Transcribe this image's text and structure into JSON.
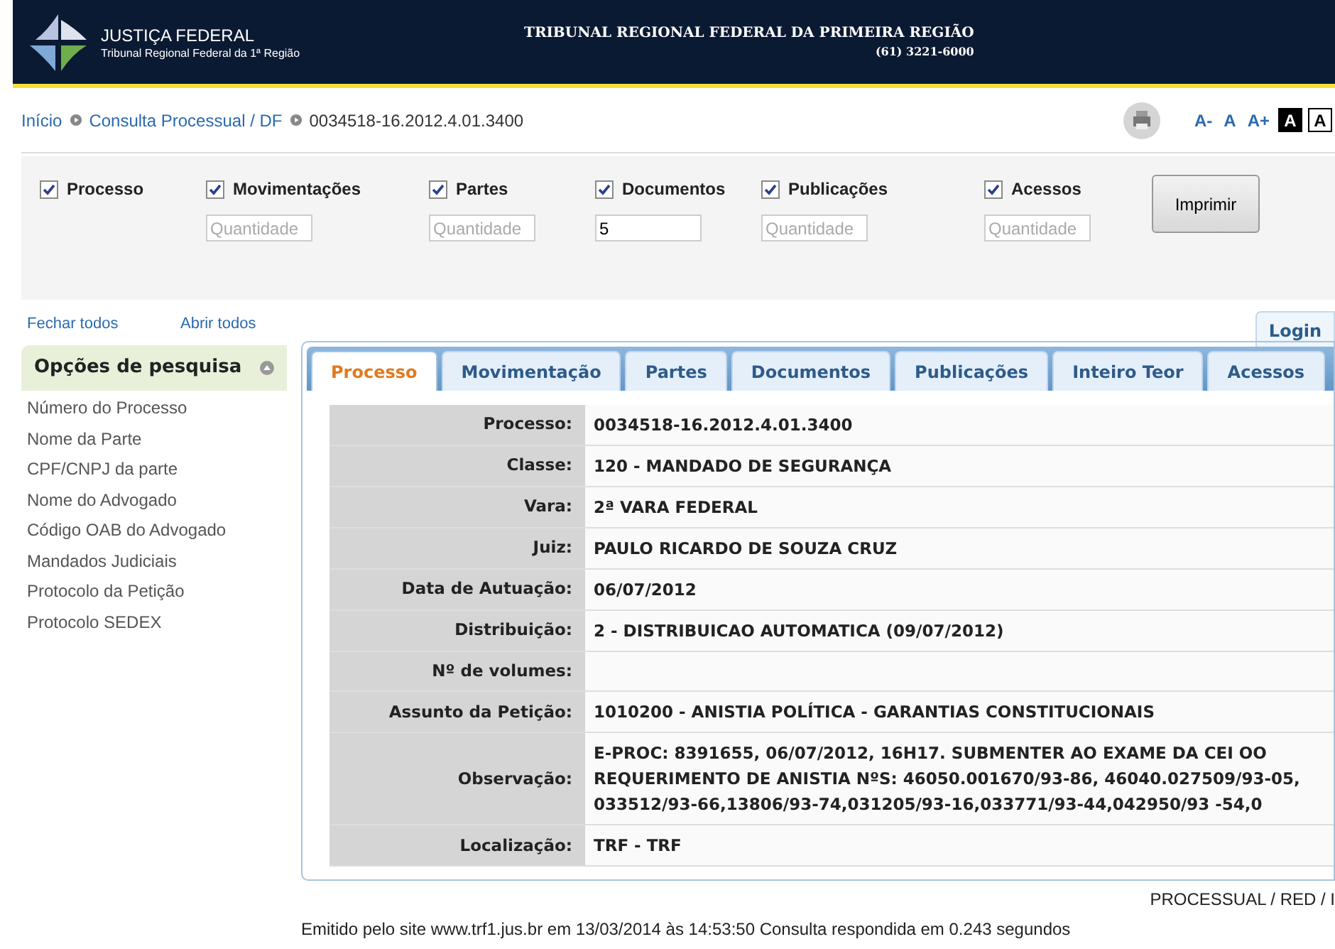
{
  "header": {
    "logo_title": "JUSTIÇA FEDERAL",
    "logo_subtitle": "Tribunal Regional Federal da 1ª Região",
    "title": "TRIBUNAL REGIONAL FEDERAL DA PRIMEIRA REGIÃO",
    "phone": "(61) 3221-6000"
  },
  "breadcrumb": [
    {
      "label": "Início",
      "link": true
    },
    {
      "label": "Consulta Processual / DF",
      "link": true
    },
    {
      "label": "0034518-16.2012.4.01.3400",
      "link": false
    }
  ],
  "font_sizes": [
    {
      "label": "A-",
      "kind": "link"
    },
    {
      "label": "A",
      "kind": "link"
    },
    {
      "label": "A+",
      "kind": "link"
    },
    {
      "label": "A",
      "kind": "dark"
    },
    {
      "label": "A",
      "kind": "light"
    }
  ],
  "print_options": [
    {
      "label": "Processo",
      "checked": true
    },
    {
      "label": "Movimentações",
      "checked": true,
      "quantity": {
        "placeholder": "Quantidade"
      }
    },
    {
      "label": "Partes",
      "checked": true,
      "quantity": {
        "placeholder": "Quantidade"
      }
    },
    {
      "label": "Documentos",
      "checked": true,
      "quantity": {
        "value": "5"
      }
    },
    {
      "label": "Publicações",
      "checked": true,
      "quantity": {
        "placeholder": "Quantidade"
      }
    },
    {
      "label": "Acessos",
      "checked": true,
      "quantity": {
        "placeholder": "Quantidade"
      }
    }
  ],
  "print_button": "Imprimir",
  "toggle_links": [
    "Fechar todos",
    "Abrir todos"
  ],
  "login_button": "Login",
  "sidebar": {
    "title": "Opções de pesquisa",
    "expanded": true,
    "items": [
      "Número do Processo",
      "Nome da Parte",
      "CPF/CNPJ da parte",
      "Nome do Advogado",
      "Código OAB do Advogado",
      "Mandados Judiciais",
      "Protocolo da Petição",
      "Protocolo SEDEX"
    ]
  },
  "tabs": [
    {
      "label": "Processo",
      "selected": true
    },
    {
      "label": "Movimentação",
      "selected": false
    },
    {
      "label": "Partes",
      "selected": false
    },
    {
      "label": "Documentos",
      "selected": false
    },
    {
      "label": "Publicações",
      "selected": false
    },
    {
      "label": "Inteiro Teor",
      "selected": false
    },
    {
      "label": "Acessos",
      "selected": false
    }
  ],
  "details": [
    {
      "label": "Processo:",
      "value": "0034518-16.2012.4.01.3400"
    },
    {
      "label": "Classe:",
      "value": "120 - MANDADO DE SEGURANÇA"
    },
    {
      "label": "Vara:",
      "value": "2ª VARA FEDERAL"
    },
    {
      "label": "Juiz:",
      "value": "PAULO RICARDO DE SOUZA CRUZ"
    },
    {
      "label": "Data de Autuação:",
      "value": "06/07/2012"
    },
    {
      "label": "Distribuição:",
      "value": "2 - DISTRIBUICAO AUTOMATICA (09/07/2012)"
    },
    {
      "label": "Nº de volumes:"
    },
    {
      "label": "Assunto da Petição:",
      "value": "1010200 - ANISTIA POLÍTICA - GARANTIAS CONSTITUCIONAIS"
    },
    {
      "label": "Observação:",
      "value": "E-PROC: 8391655, 06/07/2012, 16H17. SUBMENTER AO EXAME DA CEI OO REQUERIMENTO DE ANISTIA NºS: 46050.001670/93-86, 46040.027509/93-05, 033512/93-66,13806/93-74,031205/93-16,033771/93-44,042950/93 -54,0"
    },
    {
      "label": "Localização:",
      "value": "TRF - TRF"
    }
  ],
  "footer_code": "PROCESSUAL / RED / I",
  "footer_note": "Emitido pelo site www.trf1.jus.br em 13/03/2014 às 14:53:50 Consulta respondida em 0.243 segundos"
}
